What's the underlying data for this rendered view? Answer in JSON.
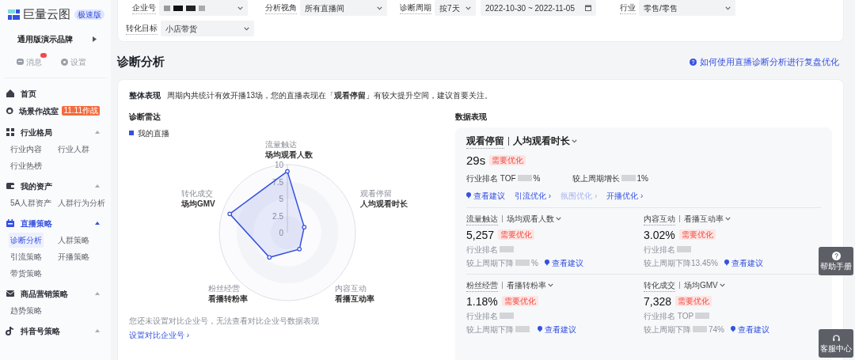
{
  "brand": {
    "name": "巨量云图",
    "edition": "极速版"
  },
  "account": {
    "name": "通用版演示品牌"
  },
  "quick_links": [
    {
      "kind": "messages",
      "label": "消息",
      "has_badge": true
    },
    {
      "kind": "settings",
      "label": "设置",
      "has_badge": false
    }
  ],
  "nav": [
    {
      "label": "首页",
      "selected": false
    },
    {
      "label": "场景作战室",
      "tag": "11.11作战",
      "selected": false
    },
    {
      "label": "行业格局",
      "selected": false,
      "expanded": true,
      "children": [
        {
          "label": "行业内容",
          "selected": false
        },
        {
          "label": "行业人群",
          "selected": false
        },
        {
          "label": "行业热榜",
          "selected": false
        }
      ]
    },
    {
      "label": "我的资产",
      "selected": false,
      "expanded": true,
      "children": [
        {
          "label": "5A人群资产",
          "selected": false
        },
        {
          "label": "人群行为分析",
          "selected": false
        }
      ]
    },
    {
      "label": "直播策略",
      "selected": true,
      "expanded": true,
      "children": [
        {
          "label": "诊断分析",
          "selected": true
        },
        {
          "label": "人群策略",
          "selected": false
        },
        {
          "label": "引流策略",
          "selected": false
        },
        {
          "label": "开播策略",
          "selected": false
        },
        {
          "label": "带货策略",
          "selected": false
        }
      ]
    },
    {
      "label": "商品营销策略",
      "selected": false,
      "expanded": true,
      "children": [
        {
          "label": "趋势策略",
          "selected": false
        }
      ]
    },
    {
      "label": "抖音号策略",
      "selected": false,
      "expanded": true
    }
  ],
  "filters": [
    [
      {
        "label": "企业号",
        "kind": "redacted"
      },
      {
        "label": "分析视角",
        "kind": "select",
        "value": "所有直播间"
      },
      {
        "label": "诊断周期",
        "kind": "select",
        "value": "按7天"
      },
      {
        "kind": "date",
        "value": "2022-10-30 ~ 2022-11-05"
      },
      {
        "label": "行业",
        "kind": "select",
        "value": "零售/零售"
      }
    ],
    [
      {
        "label": "转化目标",
        "kind": "select",
        "value": "小店带货"
      }
    ]
  ],
  "section": {
    "title": "诊断分析",
    "help_link": "如何使用直播诊断分析进行复盘优化"
  },
  "summary": {
    "label": "整体表现",
    "text": "周期内共统计有效开播13场，您的直播表现在「**观看停留**」有较大提升空间，建议首要关注。"
  },
  "radar": {
    "title": "诊断雷达",
    "axis_groups": [
      "流量触达",
      "观看停留",
      "内容互动",
      "粉丝经营",
      "转化成交"
    ],
    "chart_data": {
      "type": "radar",
      "categories": [
        "场均观看人数",
        "人均观看时长",
        "看播互动率",
        "看播转粉率",
        "场均GMV"
      ],
      "ylim": [
        0,
        10
      ],
      "yticks": [
        0,
        2.5,
        5,
        7.5,
        10
      ],
      "series": [
        {
          "name": "我的直播",
          "color": "#3451e0",
          "values": [
            9.0,
            2.6,
            3.0,
            4.5,
            8.9
          ]
        }
      ]
    },
    "note": "您还未设置对比企业号，无法查看对比企业号数据表现",
    "link": "设置对比企业号 ›"
  },
  "data": {
    "title": "数据表现",
    "focus": {
      "group": "观看停留",
      "metric": "人均观看时长",
      "value": "29s",
      "status": "需要优化",
      "rank": [
        {
          "kind": "text",
          "text": "行业排名 TOF"
        },
        {
          "kind": "redacted"
        },
        {
          "kind": "text",
          "text": "%"
        }
      ],
      "change": [
        {
          "kind": "text",
          "text": "较上周期增长"
        },
        {
          "kind": "redacted"
        },
        {
          "kind": "text",
          "text": "1%"
        }
      ],
      "actions": [
        {
          "kind": "tip",
          "label": "查看建议",
          "disabled": false
        },
        {
          "kind": "link",
          "label": "引流优化 ›",
          "disabled": false
        },
        {
          "kind": "link",
          "label": "氛围优化 ›",
          "disabled": true
        },
        {
          "kind": "link",
          "label": "开播优化 ›",
          "disabled": false
        }
      ]
    },
    "metrics": [
      {
        "group": "流量触达",
        "metric": "场均观看人数",
        "value": "5,257",
        "status": "需要优化",
        "rank": [
          {
            "kind": "text",
            "text": "行业排名"
          },
          {
            "kind": "redacted"
          }
        ],
        "change": [
          {
            "kind": "text",
            "text": "较上周期下降"
          },
          {
            "kind": "redacted"
          },
          {
            "kind": "text",
            "text": "%"
          }
        ],
        "tip": "查看建议"
      },
      {
        "group": "内容互动",
        "metric": "看播互动率",
        "value": "3.02%",
        "status": "需要优化",
        "rank": [
          {
            "kind": "text",
            "text": "行业排名"
          },
          {
            "kind": "redacted"
          }
        ],
        "change": [
          {
            "kind": "text",
            "text": "较上周期下降13.45%"
          }
        ],
        "tip": "查看建议"
      },
      {
        "group": "粉丝经营",
        "metric": "看播转粉率",
        "value": "1.18%",
        "status": "需要优化",
        "rank": [
          {
            "kind": "text",
            "text": "行业排名"
          },
          {
            "kind": "redacted"
          }
        ],
        "change": [
          {
            "kind": "text",
            "text": "较上周期下降"
          },
          {
            "kind": "redacted"
          }
        ],
        "tip": "查看建议"
      },
      {
        "group": "转化成交",
        "metric": "场均GMV",
        "value": "7,328",
        "status": "需要优化",
        "rank": [
          {
            "kind": "text",
            "text": "行业排名 TOP"
          },
          {
            "kind": "redacted"
          }
        ],
        "change": [
          {
            "kind": "text",
            "text": "较上周期下降"
          },
          {
            "kind": "redacted"
          },
          {
            "kind": "text",
            "text": "74%"
          }
        ],
        "tip": "查看建议"
      }
    ]
  },
  "float_buttons": [
    {
      "kind": "help",
      "label": "帮助手册"
    },
    {
      "kind": "service",
      "label": "客服中心"
    }
  ]
}
